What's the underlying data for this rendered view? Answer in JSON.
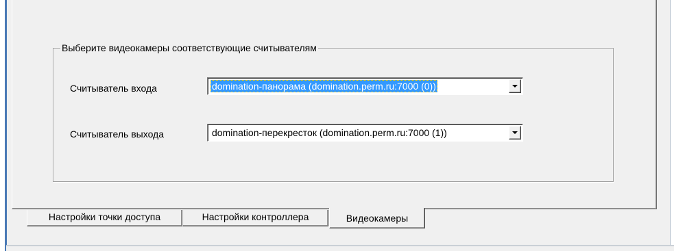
{
  "group": {
    "legend": "Выберите видеокамеры соответствующие считывателям"
  },
  "entry_reader": {
    "label": "Считыватель входа",
    "value": "domination-панорама (domination.perm.ru:7000 (0))"
  },
  "exit_reader": {
    "label": "Считыватель выхода",
    "value": "domination-перекресток (domination.perm.ru:7000 (1))"
  },
  "tabs": [
    {
      "label": "Настройки точки доступа",
      "selected": false
    },
    {
      "label": "Настройки контроллера",
      "selected": false
    },
    {
      "label": "Видеокамеры",
      "selected": true
    }
  ],
  "colors": {
    "background": "#f0f0f0",
    "selection": "#3399ff",
    "window_border": "#4a79b5"
  }
}
